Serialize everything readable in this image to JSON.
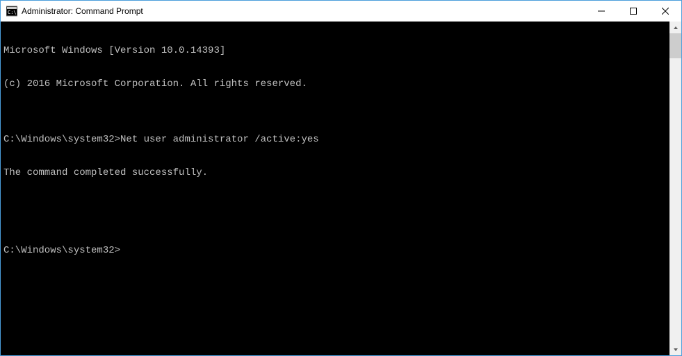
{
  "window": {
    "title": "Administrator: Command Prompt"
  },
  "terminal": {
    "lines": [
      "Microsoft Windows [Version 10.0.14393]",
      "(c) 2016 Microsoft Corporation. All rights reserved.",
      "",
      "C:\\Windows\\system32>Net user administrator /active:yes",
      "The command completed successfully.",
      "",
      "",
      "C:\\Windows\\system32>"
    ]
  }
}
